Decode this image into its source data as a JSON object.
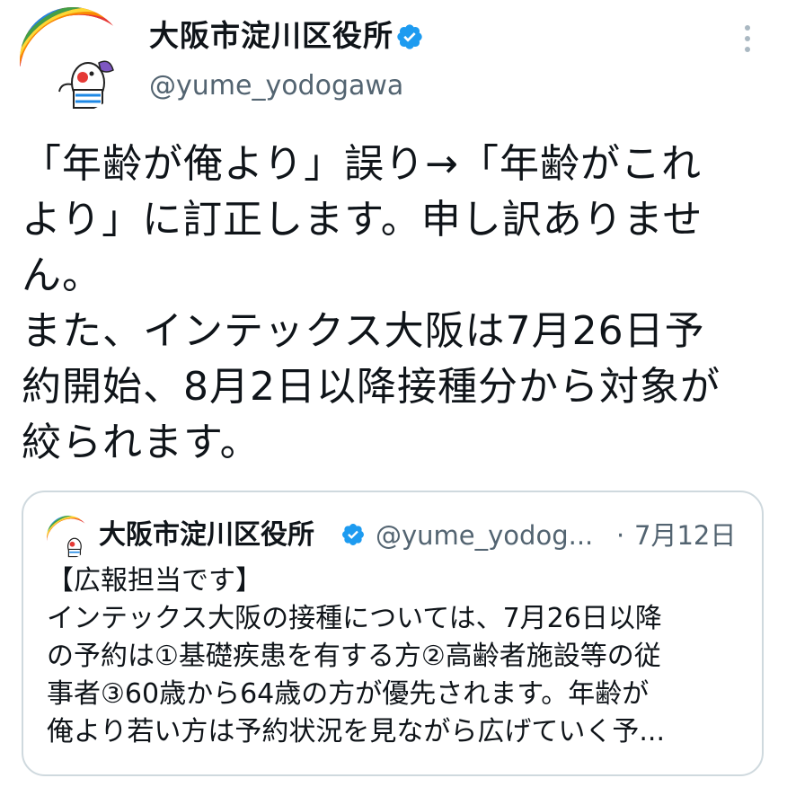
{
  "author": {
    "display_name": "大阪市淀川区役所",
    "handle": "@yume_yodogawa",
    "verified_icon": "verified-badge-icon",
    "avatar_icon": "rainbow-mascot-avatar"
  },
  "menu": {
    "icon": "more-vertical-icon"
  },
  "tweet": {
    "lines": [
      "「年齢が俺より」誤り→「年齢がこれ",
      "より」に訂正します。申し訳ありませ",
      "ん。",
      "また、インテックス大阪は7月26日予",
      "約開始、8月2日以降接種分から対象が",
      "絞られます。"
    ]
  },
  "quoted_tweet": {
    "display_name": "大阪市淀川区役所",
    "handle": "@yume_yodog...",
    "separator": "·",
    "date": "7月12日",
    "lines": [
      "【広報担当です】",
      "インテックス大阪の接種については、7月26日以降",
      "の予約は①基礎疾患を有する方②高齢者施設等の従",
      "事者③60歳から64歳の方が優先されます。年齢が",
      "俺より若い方は予約状況を見ながら広げていく予..."
    ]
  },
  "colors": {
    "text": "#0f1419",
    "secondary": "#536471",
    "verified": "#1d9bf0",
    "border": "#cfd9de"
  }
}
